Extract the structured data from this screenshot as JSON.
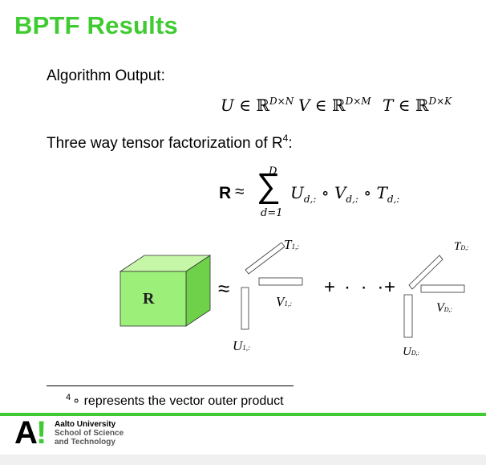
{
  "slide": {
    "title": "BPTF Results",
    "algorithm_output_label": "Algorithm Output:",
    "outputs": [
      {
        "var": "U",
        "set": "ℝ",
        "exp": "D×N"
      },
      {
        "var": "V",
        "set": "ℝ",
        "exp": "D×M"
      },
      {
        "var": "T",
        "set": "ℝ",
        "exp": "D×K"
      }
    ],
    "factorization_label": "Three way tensor factorization of R",
    "factorization_footnote_mark": "4",
    "formula": {
      "lhs": "R",
      "approx": "≈",
      "sum_upper": "D",
      "sum_lower": "d=1",
      "sum_symbol": "∑",
      "terms": [
        "U",
        "V",
        "T"
      ],
      "term_sub": "d,:",
      "op": "∘"
    },
    "diagram": {
      "cube_label": "R",
      "approx": "≈",
      "plus": "+",
      "dots": "· · ·",
      "labels_first": {
        "T": "T",
        "T_sub": "1,:",
        "V": "V",
        "V_sub": "1,:",
        "U": "U",
        "U_sub": "1,:"
      },
      "labels_last": {
        "T": "T",
        "T_sub": "D,:",
        "V": "V",
        "V_sub": "D,:",
        "U": "U",
        "U_sub": "D,:"
      }
    },
    "footnote": {
      "mark": "4",
      "text": "∘ represents the vector outer product"
    },
    "footer": {
      "logo_letter": "A",
      "logo_mark": "!",
      "university": "Aalto University",
      "school_line1": "School of Science",
      "school_line2": "and Technology"
    },
    "colors": {
      "accent": "#3fcb31",
      "cube_front": "#9cf07a",
      "cube_side": "#6fd04a",
      "cube_top": "#c6f7a8"
    }
  }
}
